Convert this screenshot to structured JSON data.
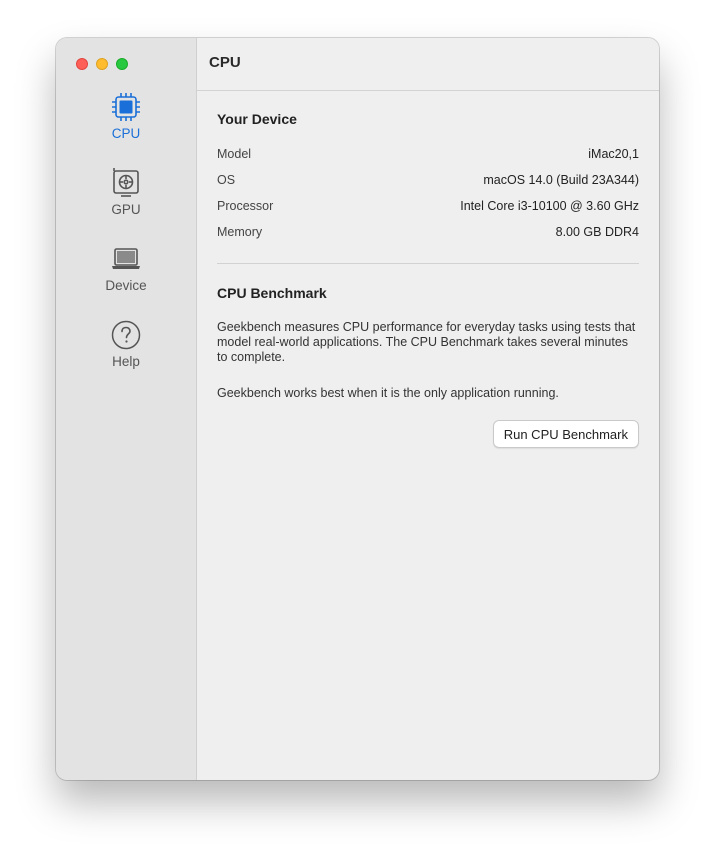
{
  "window": {
    "title": "CPU"
  },
  "sidebar": {
    "items": [
      {
        "label": "CPU",
        "icon": "cpu-chip-icon",
        "active": true
      },
      {
        "label": "GPU",
        "icon": "gpu-card-icon",
        "active": false
      },
      {
        "label": "Device",
        "icon": "laptop-icon",
        "active": false
      },
      {
        "label": "Help",
        "icon": "help-question-icon",
        "active": false
      }
    ]
  },
  "device": {
    "title": "Your Device",
    "rows": [
      {
        "label": "Model",
        "value": "iMac20,1"
      },
      {
        "label": "OS",
        "value": "macOS 14.0 (Build 23A344)"
      },
      {
        "label": "Processor",
        "value": "Intel Core i3-10100 @ 3.60 GHz"
      },
      {
        "label": "Memory",
        "value": "8.00 GB DDR4"
      }
    ]
  },
  "benchmark": {
    "title": "CPU Benchmark",
    "description": "Geekbench measures CPU performance for everyday tasks using tests that model real-world applications. The CPU Benchmark takes several minutes to complete.",
    "note": "Geekbench works best when it is the only application running.",
    "button_label": "Run CPU Benchmark"
  },
  "colors": {
    "accent": "#1a6fd8",
    "close": "#fe5f57",
    "minimize": "#febc2e",
    "maximize": "#28c840"
  }
}
